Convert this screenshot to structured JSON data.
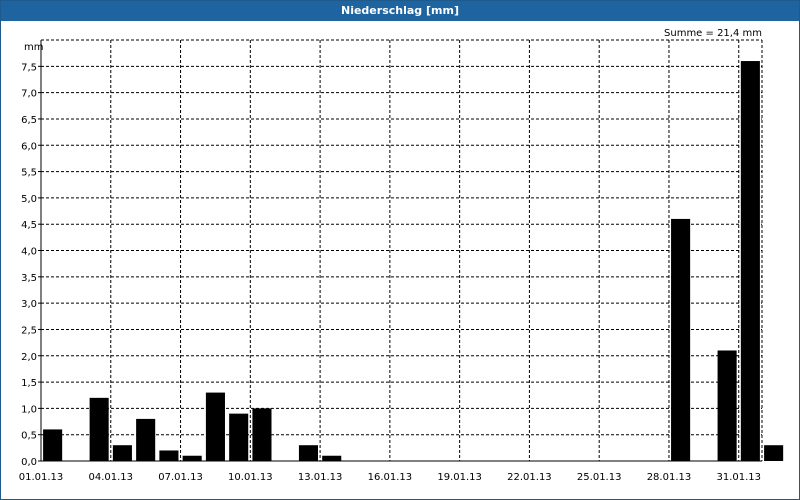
{
  "window": {
    "title": "Niederschlag [mm]"
  },
  "colors": {
    "titlebar": "#1e64a0",
    "bar": "#000000",
    "grid": "#000000"
  },
  "chart_data": {
    "type": "bar",
    "title": "Niederschlag [mm]",
    "ylabel": "mm",
    "xlabel": "",
    "summary": "Summe = 21,4 mm",
    "ylim": [
      0,
      8
    ],
    "y_ticks": [
      "0,0",
      "0,5",
      "1,0",
      "1,5",
      "2,0",
      "2,5",
      "3,0",
      "3,5",
      "4,0",
      "4,5",
      "5,0",
      "5,5",
      "6,0",
      "6,5",
      "7,0",
      "7,5"
    ],
    "x_ticks": [
      "01.01.13",
      "04.01.13",
      "07.01.13",
      "10.01.13",
      "13.01.13",
      "16.01.13",
      "19.01.13",
      "22.01.13",
      "25.01.13",
      "28.01.13",
      "31.01.13"
    ],
    "grid": true,
    "categories": [
      "01.01.13",
      "02.01.13",
      "03.01.13",
      "04.01.13",
      "05.01.13",
      "06.01.13",
      "07.01.13",
      "08.01.13",
      "09.01.13",
      "10.01.13",
      "11.01.13",
      "12.01.13",
      "13.01.13",
      "14.01.13",
      "15.01.13",
      "16.01.13",
      "17.01.13",
      "18.01.13",
      "19.01.13",
      "20.01.13",
      "21.01.13",
      "22.01.13",
      "23.01.13",
      "24.01.13",
      "25.01.13",
      "26.01.13",
      "27.01.13",
      "28.01.13",
      "29.01.13",
      "30.01.13",
      "31.01.13"
    ],
    "values": [
      0.6,
      0,
      1.2,
      0.3,
      0.8,
      0.2,
      0.1,
      1.3,
      0.9,
      1.0,
      0,
      0.3,
      0.1,
      0,
      0,
      0,
      0,
      0,
      0,
      0,
      0,
      0,
      0,
      0,
      0,
      0,
      0,
      4.6,
      0,
      2.1,
      7.6,
      0.3
    ]
  }
}
